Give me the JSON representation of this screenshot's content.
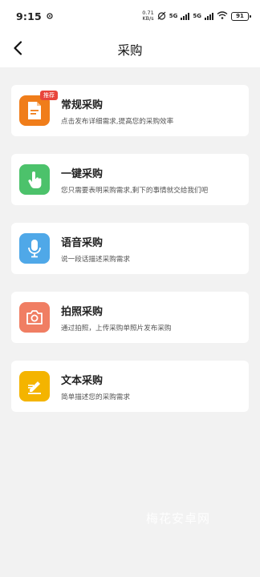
{
  "status_bar": {
    "time": "9:15",
    "notification_icon": "notification-icon",
    "speed_value": "0.71",
    "speed_unit": "KB/s",
    "sig1": "5G",
    "sig2": "5G",
    "battery": "91"
  },
  "nav": {
    "title": "采购"
  },
  "items": [
    {
      "title": "常规采购",
      "desc": "点击发布详细需求,提高您的采购效率",
      "badge": "推荐",
      "icon": "document-icon",
      "color": "#f07d1a"
    },
    {
      "title": "一键采购",
      "desc": "您只需要表明采购需求,剩下的事情就交给我们吧",
      "icon": "tap-finger-icon",
      "color": "#4cc26b"
    },
    {
      "title": "语音采购",
      "desc": "说一段话描述采购需求",
      "icon": "microphone-icon",
      "color": "#4fa8e8"
    },
    {
      "title": "拍照采购",
      "desc": "通过拍照，上传采购单照片发布采购",
      "icon": "camera-icon",
      "color": "#f07e63"
    },
    {
      "title": "文本采购",
      "desc": "简单描述您的采购需求",
      "icon": "edit-text-icon",
      "color": "#f4b400"
    }
  ],
  "watermark": "梅花安卓网"
}
